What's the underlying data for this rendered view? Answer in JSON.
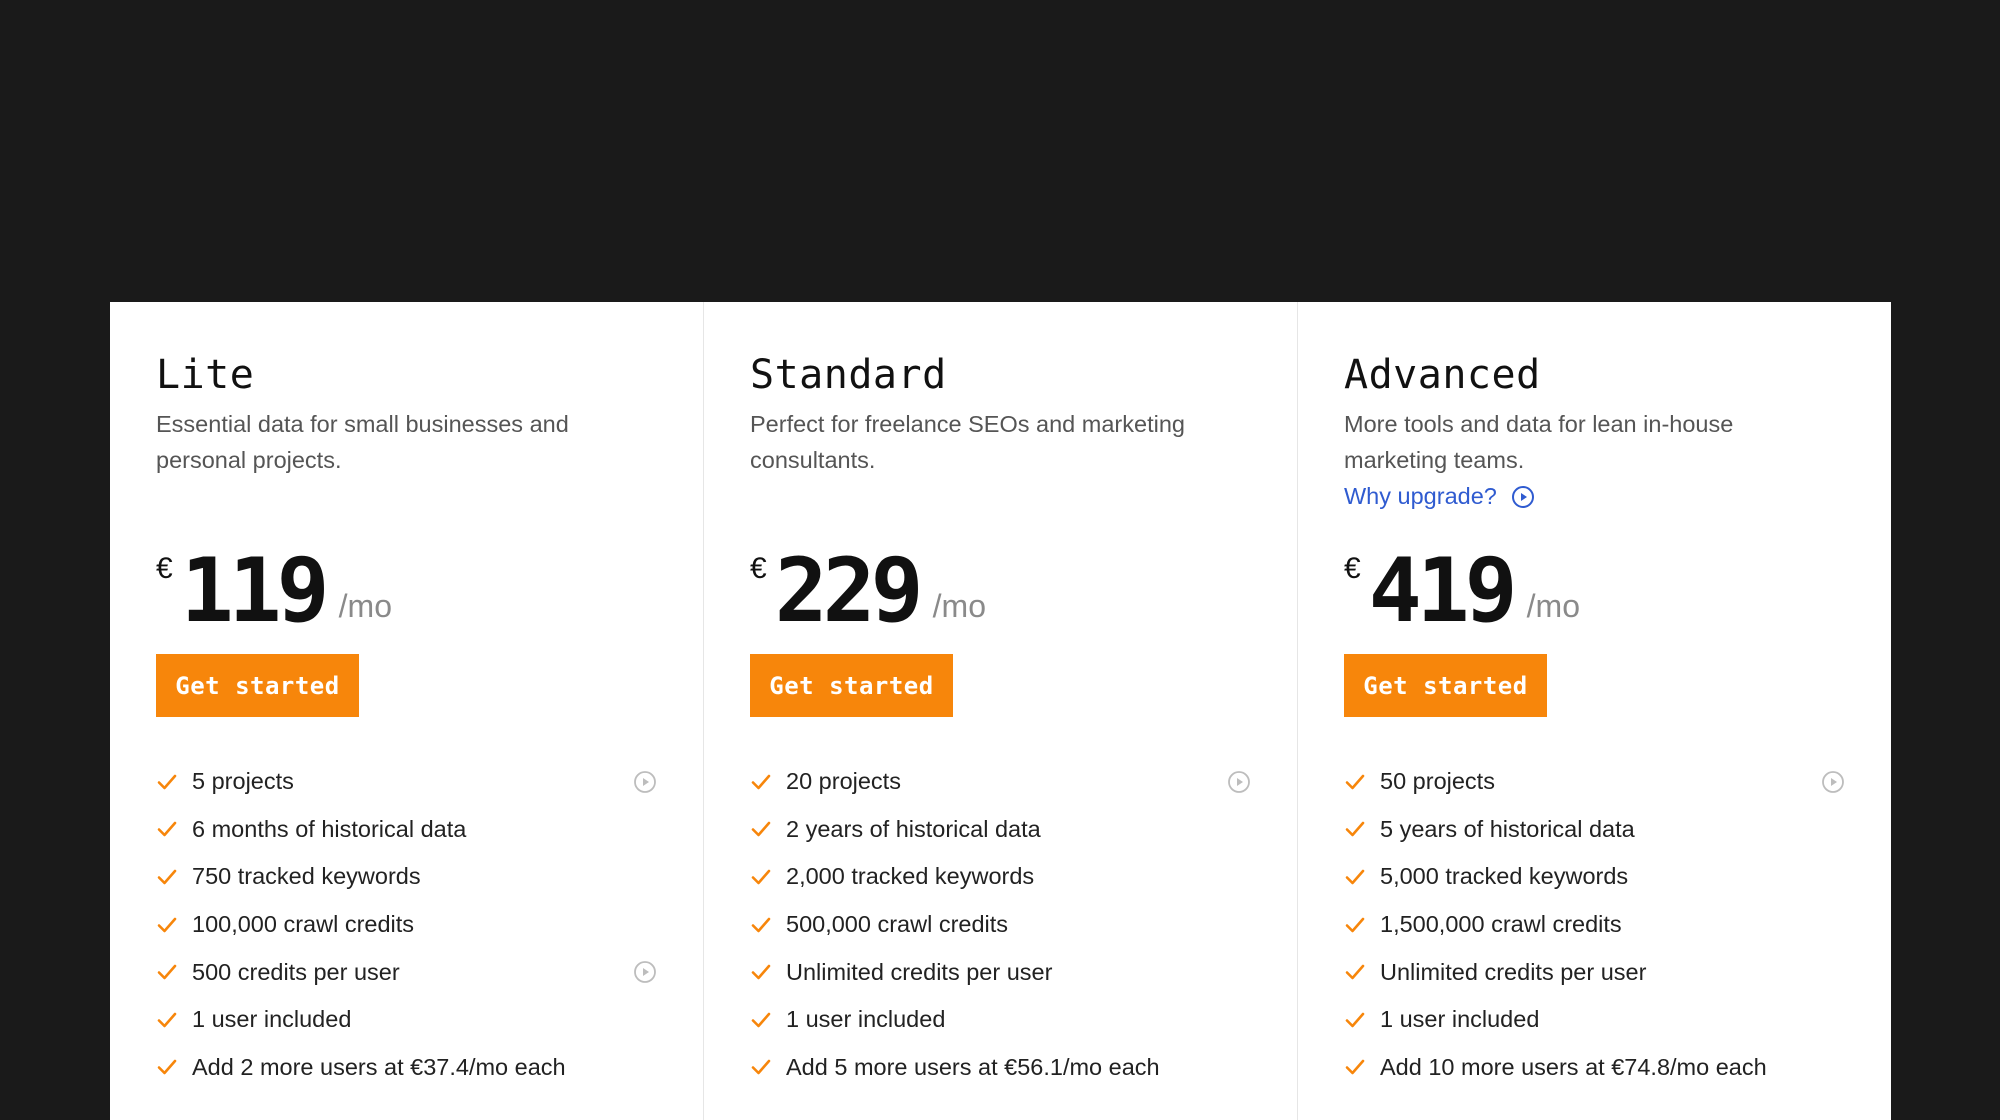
{
  "colors": {
    "background": "#1a1a1a",
    "card": "#ffffff",
    "accent": "#f7860b",
    "link": "#2f5bd0",
    "check": "#f7860b"
  },
  "plans": [
    {
      "name": "Lite",
      "description": "Essential data for small businesses and personal projects.",
      "upgrade_link": "",
      "currency": "€",
      "price": "119",
      "period": "/mo",
      "cta": "Get started",
      "features": [
        "5 projects",
        "6 months of historical data",
        "750 tracked keywords",
        "100,000 crawl credits",
        "500 credits per user",
        "1 user included",
        "Add 2 more users at €37.4/mo each"
      ]
    },
    {
      "name": "Standard",
      "description": "Perfect for freelance SEOs and marketing consultants.",
      "upgrade_link": "",
      "currency": "€",
      "price": "229",
      "period": "/mo",
      "cta": "Get started",
      "features": [
        "20 projects",
        "2 years of historical data",
        "2,000 tracked keywords",
        "500,000 crawl credits",
        "Unlimited credits per user",
        "1 user included",
        "Add 5 more users at €56.1/mo each"
      ]
    },
    {
      "name": "Advanced",
      "description": "More tools and data for lean in-house marketing teams.",
      "upgrade_link": "Why upgrade?",
      "currency": "€",
      "price": "419",
      "period": "/mo",
      "cta": "Get started",
      "features": [
        "50 projects",
        "5 years of historical data",
        "5,000 tracked keywords",
        "1,500,000 crawl credits",
        "Unlimited credits per user",
        "1 user included",
        "Add 10 more users at €74.8/mo each"
      ]
    }
  ]
}
